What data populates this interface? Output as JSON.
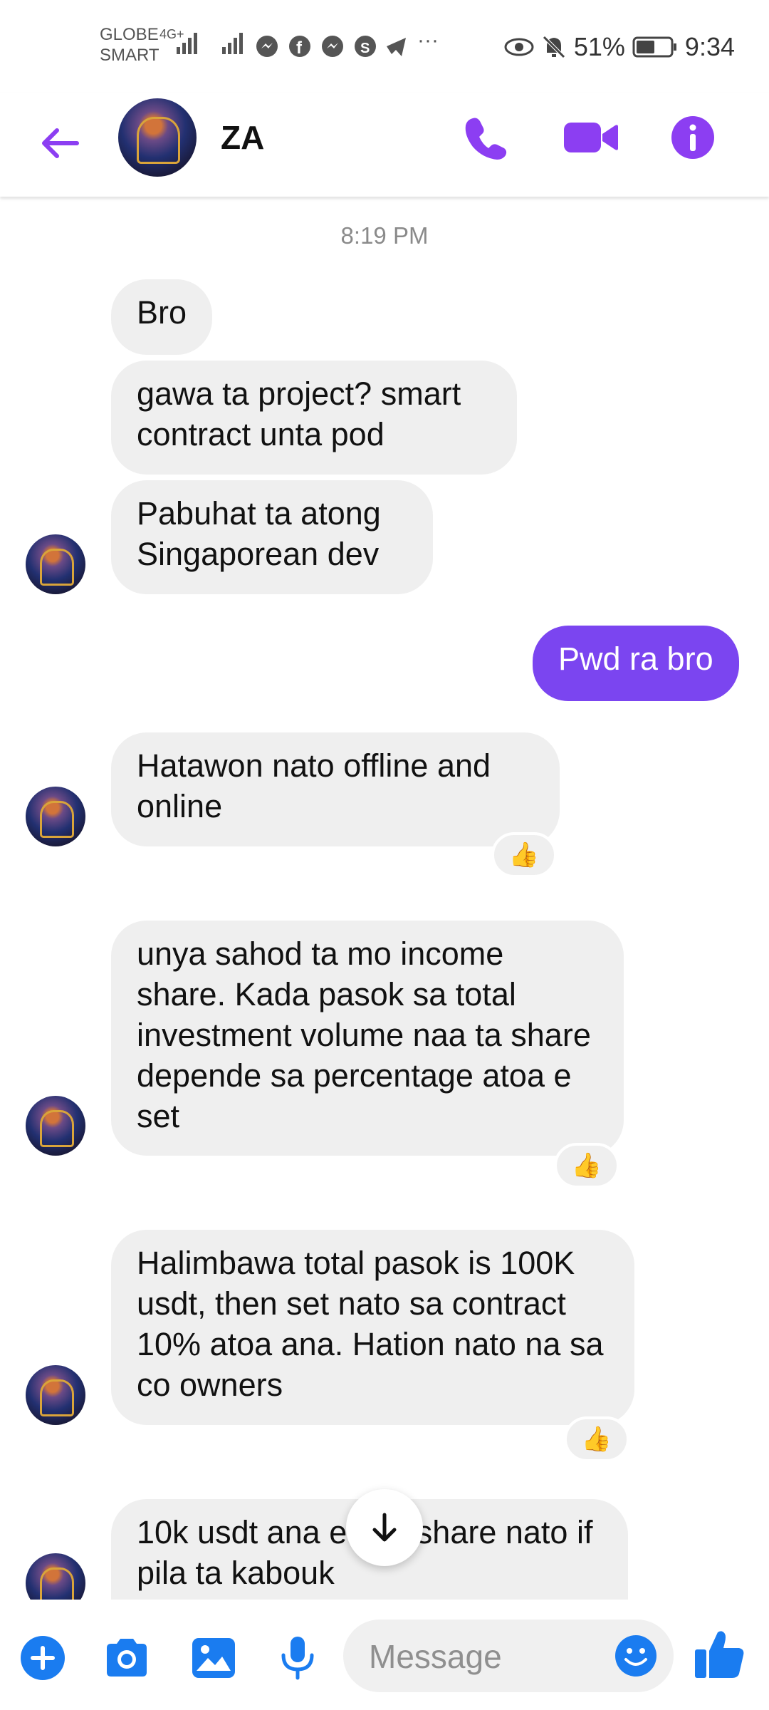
{
  "status_bar": {
    "carrier_1": "GLOBE",
    "carrier_2": "SMART",
    "network": "4G+",
    "overflow": "···",
    "battery": "51%",
    "time": "9:34"
  },
  "header": {
    "contact_name": "ZA",
    "icons": [
      "back-arrow-icon",
      "phone-icon",
      "video-icon",
      "info-icon"
    ]
  },
  "conversation": {
    "timestamp": "8:19 PM",
    "messages": [
      {
        "text": "Bro",
        "sender": "other"
      },
      {
        "text": "gawa ta project? smart contract unta pod",
        "sender": "other"
      },
      {
        "text": "Pabuhat ta atong Singaporean dev",
        "sender": "other"
      },
      {
        "text": "Pwd ra bro",
        "sender": "me"
      },
      {
        "text": "Hatawon nato offline and online",
        "sender": "other",
        "reaction": "👍"
      },
      {
        "text": "unya sahod ta mo income share. Kada pasok sa total investment volume naa ta share depende sa percentage atoa e set",
        "sender": "other",
        "reaction": "👍"
      },
      {
        "text": "Halimbawa total pasok is 100K usdt, then set nato sa contract 10% atoa ana. Hation nato na sa co owners",
        "sender": "other",
        "reaction": "👍"
      },
      {
        "text": "10k usdt ana equal share nato if pila ta kabouk",
        "sender": "other"
      }
    ]
  },
  "composer": {
    "placeholder": "Message",
    "icons": [
      "plus-icon",
      "camera-icon",
      "image-icon",
      "microphone-icon",
      "emoji-icon",
      "thumbs-up-icon"
    ]
  },
  "colors": {
    "accent": "#7b45f0",
    "icon_purple": "#8c3ef2",
    "composer_blue": "#1a7cf0",
    "bubble_gray": "#efefef"
  }
}
